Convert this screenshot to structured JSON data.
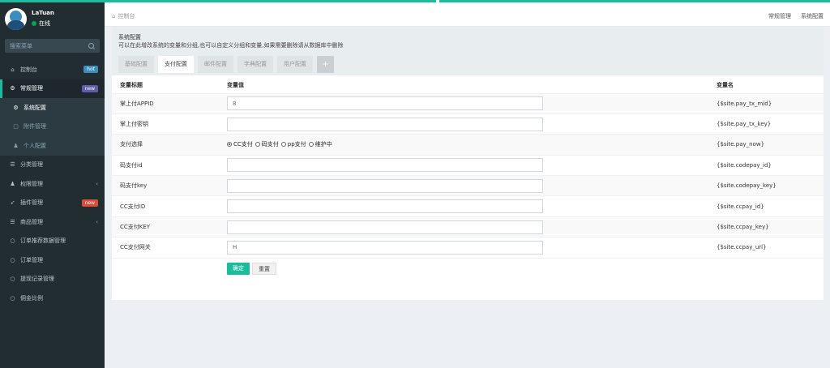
{
  "user": {
    "name": "LaTuan",
    "status": "在线"
  },
  "search": {
    "placeholder": "搜索菜单"
  },
  "menu": [
    {
      "icon": "dashboard-icon",
      "glyph": "⌂",
      "label": "控制台",
      "badge": "hot",
      "badge_color": "#3c8dbc"
    },
    {
      "icon": "cogs-icon",
      "glyph": "⚙",
      "label": "常规管理",
      "badge": "new",
      "badge_color": "#605ca8",
      "active": true
    },
    {
      "icon": "cog-icon",
      "glyph": "⚙",
      "label": "系统配置",
      "sub": true,
      "active": true
    },
    {
      "icon": "file-icon",
      "glyph": "▢",
      "label": "附件管理",
      "sub": true
    },
    {
      "icon": "user-icon",
      "glyph": "♟",
      "label": "个人配置",
      "sub": true
    },
    {
      "icon": "list-icon",
      "glyph": "☰",
      "label": "分类管理"
    },
    {
      "icon": "group-icon",
      "glyph": "♟",
      "label": "权限管理",
      "chevron": true
    },
    {
      "icon": "rocket-icon",
      "glyph": "➶",
      "label": "插件管理",
      "badge": "new",
      "badge_color": "#dd4b39"
    },
    {
      "icon": "goods-icon",
      "glyph": "☰",
      "label": "商品管理",
      "chevron": true
    },
    {
      "icon": "circle-icon",
      "glyph": "○",
      "label": "订单推荐数据管理"
    },
    {
      "icon": "circle-icon",
      "glyph": "○",
      "label": "订单管理"
    },
    {
      "icon": "circle-icon",
      "glyph": "○",
      "label": "提现记录管理"
    },
    {
      "icon": "circle-icon",
      "glyph": "○",
      "label": "佣金比例"
    }
  ],
  "header": {
    "breadcrumb": "控制台",
    "right_links": [
      "常规管理",
      "系统配置"
    ]
  },
  "panel": {
    "title": "系统配置",
    "desc": "可以在此增改系统的变量和分组,也可以自定义分组和变量,如果需要删除请从数据库中删除",
    "tabs": [
      "基础配置",
      "支付配置",
      "邮件配置",
      "字典配置",
      "用户配置"
    ],
    "active_tab": 1,
    "add_tab": "+"
  },
  "table": {
    "headers": [
      "变量标题",
      "变量值",
      "变量名"
    ],
    "rows": [
      {
        "title": "掌上付APPID",
        "value": "8",
        "var": "{$site.pay_tx_mid}"
      },
      {
        "title": "掌上付密钥",
        "value": "",
        "var": "{$site.pay_tx_key}"
      },
      {
        "title": "支付选择",
        "type": "radio",
        "var": "{$site.pay_now}"
      },
      {
        "title": "码支付id",
        "value": "",
        "var": "{$site.codepay_id}"
      },
      {
        "title": "码支付key",
        "value": "",
        "var": "{$site.codepay_key}"
      },
      {
        "title": "CC支付ID",
        "value": "",
        "var": "{$site.ccpay_id}"
      },
      {
        "title": "CC支付KEY",
        "value": "",
        "var": "{$site.ccpay_key}"
      },
      {
        "title": "CC支付网关",
        "value": "H",
        "var": "{$site.ccpay_url}"
      }
    ],
    "radio_options": [
      "CC支付",
      "码支付",
      "pp支付",
      "维护中"
    ],
    "radio_selected": 0
  },
  "buttons": {
    "ok": "确定",
    "reset": "重置"
  },
  "colors": {
    "accent": "#1abc9c",
    "sidebar": "#222d32"
  }
}
